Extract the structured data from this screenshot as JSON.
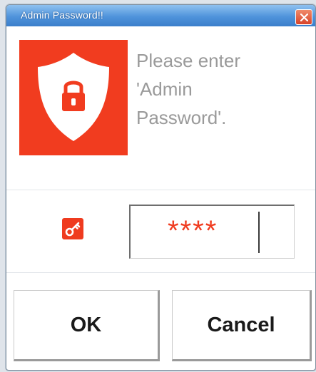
{
  "window": {
    "title": "Admin Password!!",
    "close_icon": "close-icon"
  },
  "message": {
    "line1": "Please enter",
    "line2": "'Admin",
    "line3": "Password'."
  },
  "icons": {
    "shield": "shield-lock-icon",
    "key": "key-icon"
  },
  "password_field": {
    "value": "****"
  },
  "buttons": {
    "ok_label": "OK",
    "cancel_label": "Cancel"
  },
  "colors": {
    "accent_red": "#f13c1f",
    "title_bar_blue": "#4f93db",
    "prompt_text": "#9a9a9a"
  }
}
